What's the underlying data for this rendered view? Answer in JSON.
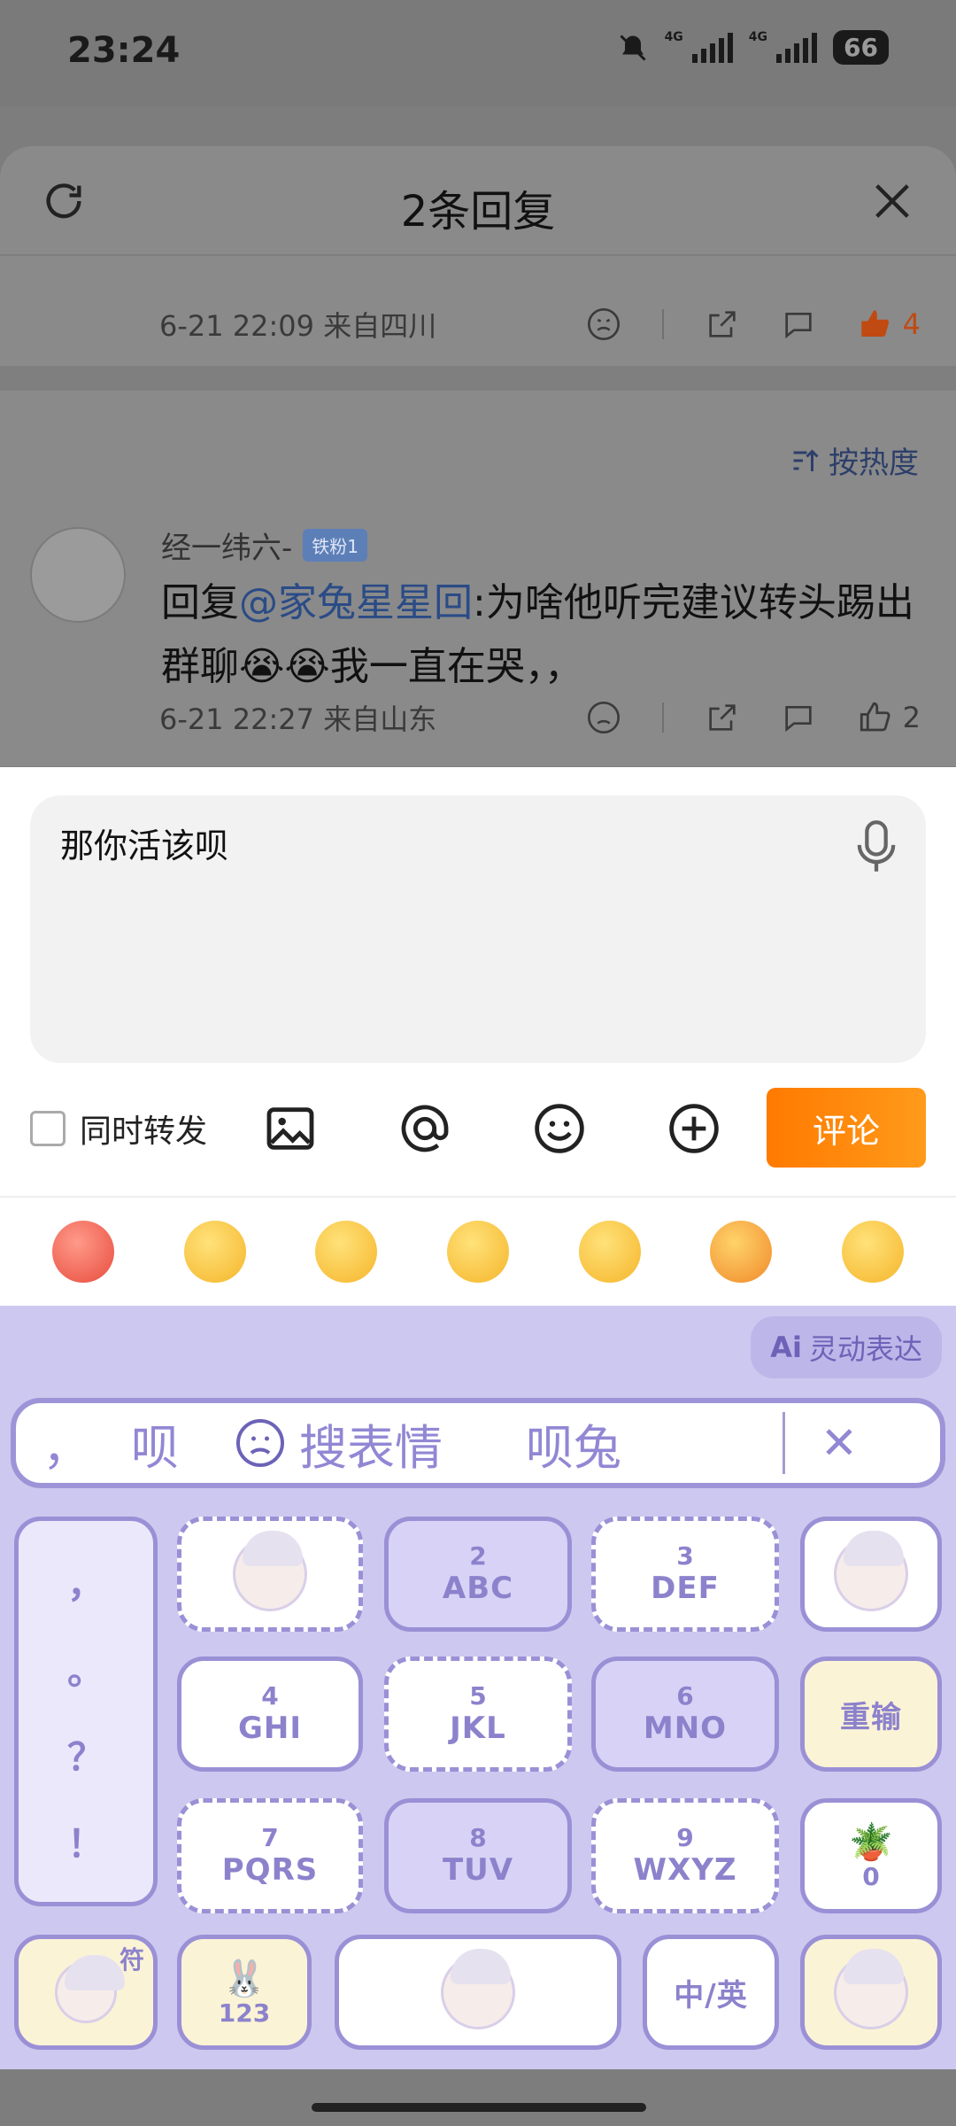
{
  "status_bar": {
    "time": "23:24",
    "net1": "4G",
    "net2": "4G",
    "battery": "66"
  },
  "sheet": {
    "title": "2条回复",
    "refresh_icon": "refresh-icon",
    "close_icon": "close-icon",
    "top_comment": {
      "meta": "6-21 22:09  来自四川",
      "like_count": "4"
    },
    "sort_label": "按热度",
    "reply": {
      "username": "经一纬六-",
      "badge": "铁粉1",
      "prefix": "回复",
      "mention": "@家兔星星回",
      "text": ":为啥他听完建议转头踢出群聊😭😭我一直在哭，，",
      "meta": "6-21 22:27  来自山东",
      "like_count": "2"
    }
  },
  "composer": {
    "input_value": "那你活该呗",
    "forward_label": "同时转发",
    "submit_label": "评论"
  },
  "keyboard": {
    "ai_label": "灵动表达",
    "candidates": [
      "，",
      "呗",
      "搜表情",
      "呗兔"
    ],
    "punct": [
      "，",
      "。",
      "？",
      "！"
    ],
    "keys": [
      {
        "num": "2",
        "letters": "ABC"
      },
      {
        "num": "3",
        "letters": "DEF"
      },
      {
        "num": "4",
        "letters": "GHI"
      },
      {
        "num": "5",
        "letters": "JKL"
      },
      {
        "num": "6",
        "letters": "MNO"
      },
      {
        "num": "7",
        "letters": "PQRS"
      },
      {
        "num": "8",
        "letters": "TUV"
      },
      {
        "num": "9",
        "letters": "WXYZ"
      }
    ],
    "reenter_label": "重输",
    "zero_label": "0",
    "symbol_label": "符",
    "num_label": "123",
    "lang_label": "中/英"
  }
}
